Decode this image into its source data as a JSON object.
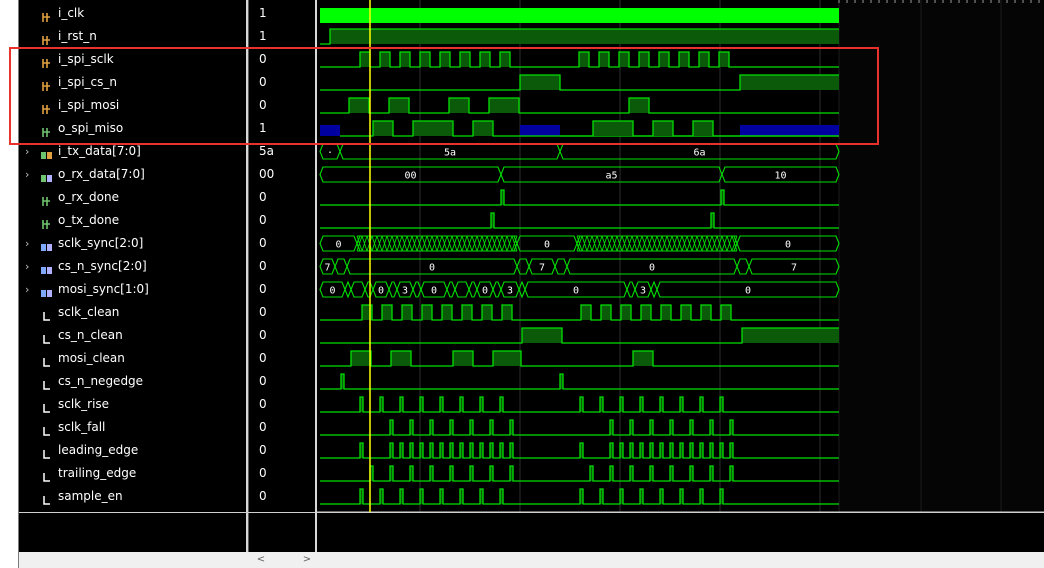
{
  "signals": [
    {
      "id": "i_clk",
      "name": "i_clk",
      "value": "1",
      "kind": "bit",
      "type": "input",
      "expand": false
    },
    {
      "id": "i_rst_n",
      "name": "i_rst_n",
      "value": "1",
      "kind": "bit",
      "type": "input",
      "expand": false
    },
    {
      "id": "i_spi_sclk",
      "name": "i_spi_sclk",
      "value": "0",
      "kind": "bit",
      "type": "input",
      "expand": false
    },
    {
      "id": "i_spi_cs_n",
      "name": "i_spi_cs_n",
      "value": "0",
      "kind": "bit",
      "type": "input",
      "expand": false
    },
    {
      "id": "i_spi_mosi",
      "name": "i_spi_mosi",
      "value": "0",
      "kind": "bit",
      "type": "input",
      "expand": false
    },
    {
      "id": "o_spi_miso",
      "name": "o_spi_miso",
      "value": "1",
      "kind": "bit",
      "type": "output",
      "expand": false
    },
    {
      "id": "i_tx_data",
      "name": "i_tx_data[7:0]",
      "value": "5a",
      "kind": "bus",
      "type": "input",
      "expand": true
    },
    {
      "id": "o_rx_data",
      "name": "o_rx_data[7:0]",
      "value": "00",
      "kind": "bus",
      "type": "output",
      "expand": true
    },
    {
      "id": "o_rx_done",
      "name": "o_rx_done",
      "value": "0",
      "kind": "bit",
      "type": "output",
      "expand": false
    },
    {
      "id": "o_tx_done",
      "name": "o_tx_done",
      "value": "0",
      "kind": "bit",
      "type": "output",
      "expand": false
    },
    {
      "id": "sclk_sync",
      "name": "sclk_sync[2:0]",
      "value": "0",
      "kind": "bus",
      "type": "internal",
      "expand": true
    },
    {
      "id": "cs_n_sync",
      "name": "cs_n_sync[2:0]",
      "value": "0",
      "kind": "bus",
      "type": "internal",
      "expand": true
    },
    {
      "id": "mosi_sync",
      "name": "mosi_sync[1:0]",
      "value": "0",
      "kind": "bus",
      "type": "internal",
      "expand": true
    },
    {
      "id": "sclk_clean",
      "name": "sclk_clean",
      "value": "0",
      "kind": "bit",
      "type": "internal",
      "expand": false
    },
    {
      "id": "cs_n_clean",
      "name": "cs_n_clean",
      "value": "0",
      "kind": "bit",
      "type": "internal",
      "expand": false
    },
    {
      "id": "mosi_clean",
      "name": "mosi_clean",
      "value": "0",
      "kind": "bit",
      "type": "internal",
      "expand": false
    },
    {
      "id": "cs_n_negedge",
      "name": "cs_n_negedge",
      "value": "0",
      "kind": "bit",
      "type": "internal",
      "expand": false
    },
    {
      "id": "sclk_rise",
      "name": "sclk_rise",
      "value": "0",
      "kind": "bit",
      "type": "internal",
      "expand": false
    },
    {
      "id": "sclk_fall",
      "name": "sclk_fall",
      "value": "0",
      "kind": "bit",
      "type": "internal",
      "expand": false
    },
    {
      "id": "leading_edge",
      "name": "leading_edge",
      "value": "0",
      "kind": "bit",
      "type": "internal",
      "expand": false
    },
    {
      "id": "trailing_edge",
      "name": "trailing_edge",
      "value": "0",
      "kind": "bit",
      "type": "internal",
      "expand": false
    },
    {
      "id": "sample_en",
      "name": "sample_en",
      "value": "0",
      "kind": "bit",
      "type": "internal",
      "expand": false
    }
  ],
  "bus_labels": {
    "i_tx_data": [
      "·",
      "5a",
      "6a"
    ],
    "o_rx_data": [
      "00",
      "a5",
      "10"
    ],
    "sclk_sync": [
      "0",
      "0",
      "0"
    ],
    "cs_n_sync": [
      "7",
      "0",
      "7",
      "0",
      "7"
    ],
    "mosi_sync": [
      "0",
      "3",
      "0",
      "3",
      "0",
      "3",
      "0",
      "3",
      "0",
      "3",
      "0"
    ]
  },
  "colors": {
    "wave": "#00e000",
    "wave_fill": "#0a5a0a",
    "clk_fill": "#00ff00",
    "high_z": "#0000a0",
    "cursor": "#ffff00",
    "grid": "#2e2e2e",
    "highlight": "#e8322b"
  },
  "icons": {
    "input": "input-port-icon",
    "output": "output-port-icon",
    "internal": "internal-signal-icon",
    "bus": "bus-icon"
  },
  "scroll": {
    "left_arrow": "<",
    "right_arrow": ">"
  }
}
